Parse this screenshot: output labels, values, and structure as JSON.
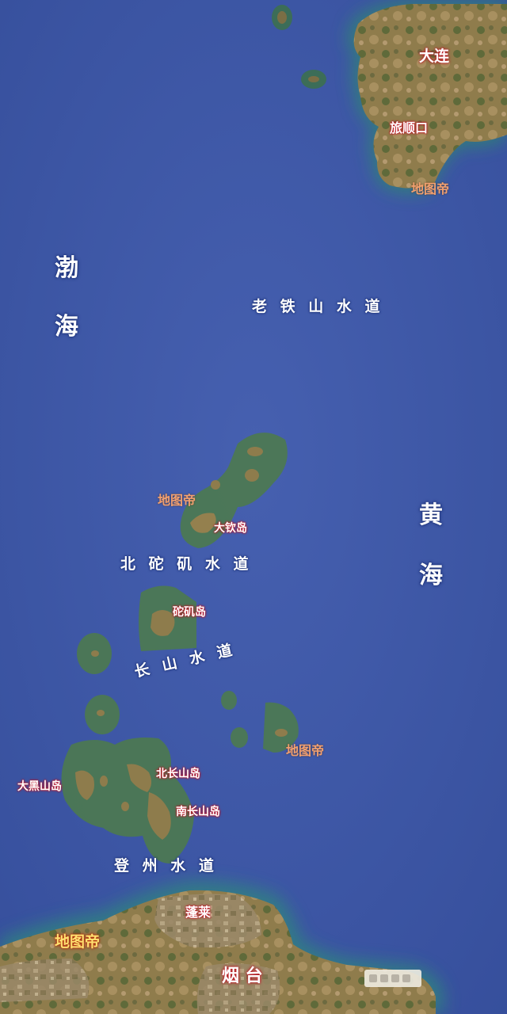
{
  "map": {
    "seas": {
      "bohai_1": "渤",
      "bohai_2": "海",
      "huanghai_1": "黄",
      "huanghai_2": "海"
    },
    "straits": {
      "laotieshan": "老 铁 山 水 道",
      "beituoji": "北 砣 矶 水 道",
      "changshan": "长 山 水 道",
      "dengzhou": "登 州 水 道"
    },
    "cities": {
      "dalian": "大连",
      "lushunkou": "旅顺口",
      "penglai": "蓬莱",
      "yantai": "烟 台"
    },
    "islands": {
      "daqin": "大钦岛",
      "tuoji": "砣矶岛",
      "beichangshan": "北长山岛",
      "nanchangshan": "南长山岛",
      "daheishan": "大黑山岛"
    },
    "watermarks": {
      "top_right": "地图帝",
      "middle_left": "地图帝",
      "middle_right": "地图帝",
      "bottom_left": "地图帝"
    },
    "colors": {
      "sea": "#3f5aa8",
      "land": "#8a7a4a",
      "island_halo": "#4d7a4f",
      "label_red": "#c01020",
      "watermark_orange": "#f1a070"
    }
  }
}
